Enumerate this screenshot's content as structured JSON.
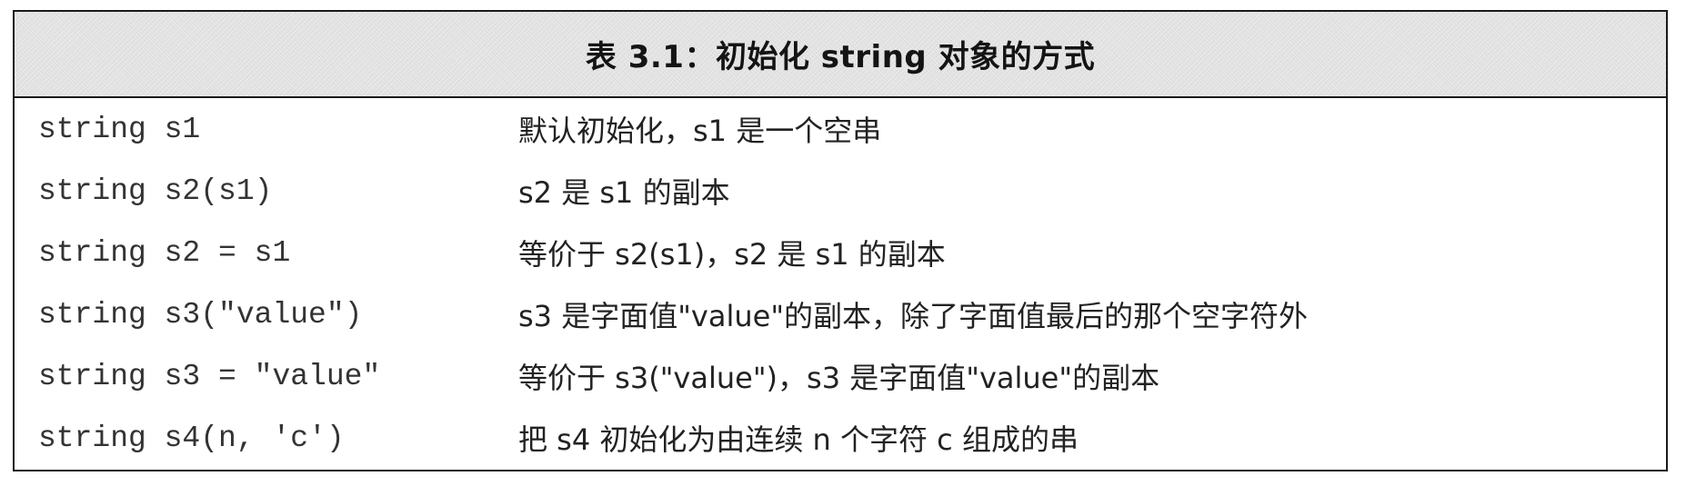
{
  "table": {
    "caption": "表 3.1：初始化 string 对象的方式",
    "rows": [
      {
        "code": "string s1",
        "desc": "默认初始化，s1 是一个空串"
      },
      {
        "code": "string s2(s1)",
        "desc": "s2 是 s1 的副本"
      },
      {
        "code": "string s2 = s1",
        "desc": "等价于 s2(s1)，s2 是 s1 的副本"
      },
      {
        "code": "string s3(\"value\")",
        "desc": "s3 是字面值\"value\"的副本，除了字面值最后的那个空字符外"
      },
      {
        "code": "string s3 = \"value\"",
        "desc": "等价于 s3(\"value\")，s3 是字面值\"value\"的副本"
      },
      {
        "code": "string s4(n, 'c')",
        "desc": "把 s4 初始化为由连续 n 个字符 c 组成的串"
      }
    ]
  }
}
